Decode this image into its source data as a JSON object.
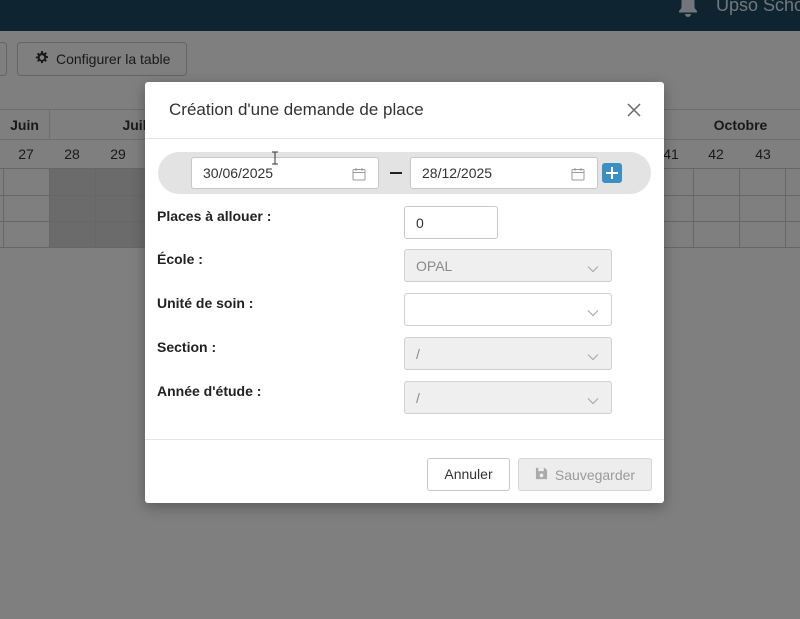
{
  "app": {
    "user_name": "Upso Scho",
    "configure_label": "Configurer la table"
  },
  "calendar": {
    "months": [
      "Juin",
      "Juil",
      "Octobre"
    ],
    "weeks": [
      "27",
      "28",
      "29",
      "41",
      "42",
      "43"
    ]
  },
  "modal": {
    "title": "Création d'une demande de place",
    "date_start": "30/06/2025",
    "date_end": "28/12/2025",
    "fields": {
      "places_label": "Places à allouer :",
      "places_value": "0",
      "ecole_label": "École :",
      "ecole_value": "OPAL",
      "unite_label": "Unité de soin :",
      "unite_value": "",
      "section_label": "Section :",
      "section_value": "/",
      "annee_label": "Année d'étude :",
      "annee_value": "/"
    },
    "cancel_label": "Annuler",
    "save_label": "Sauvegarder"
  },
  "colors": {
    "topbar": "#1c4a63",
    "accent": "#3b8fc4",
    "overlay": "rgba(0,0,0,0.5)"
  }
}
